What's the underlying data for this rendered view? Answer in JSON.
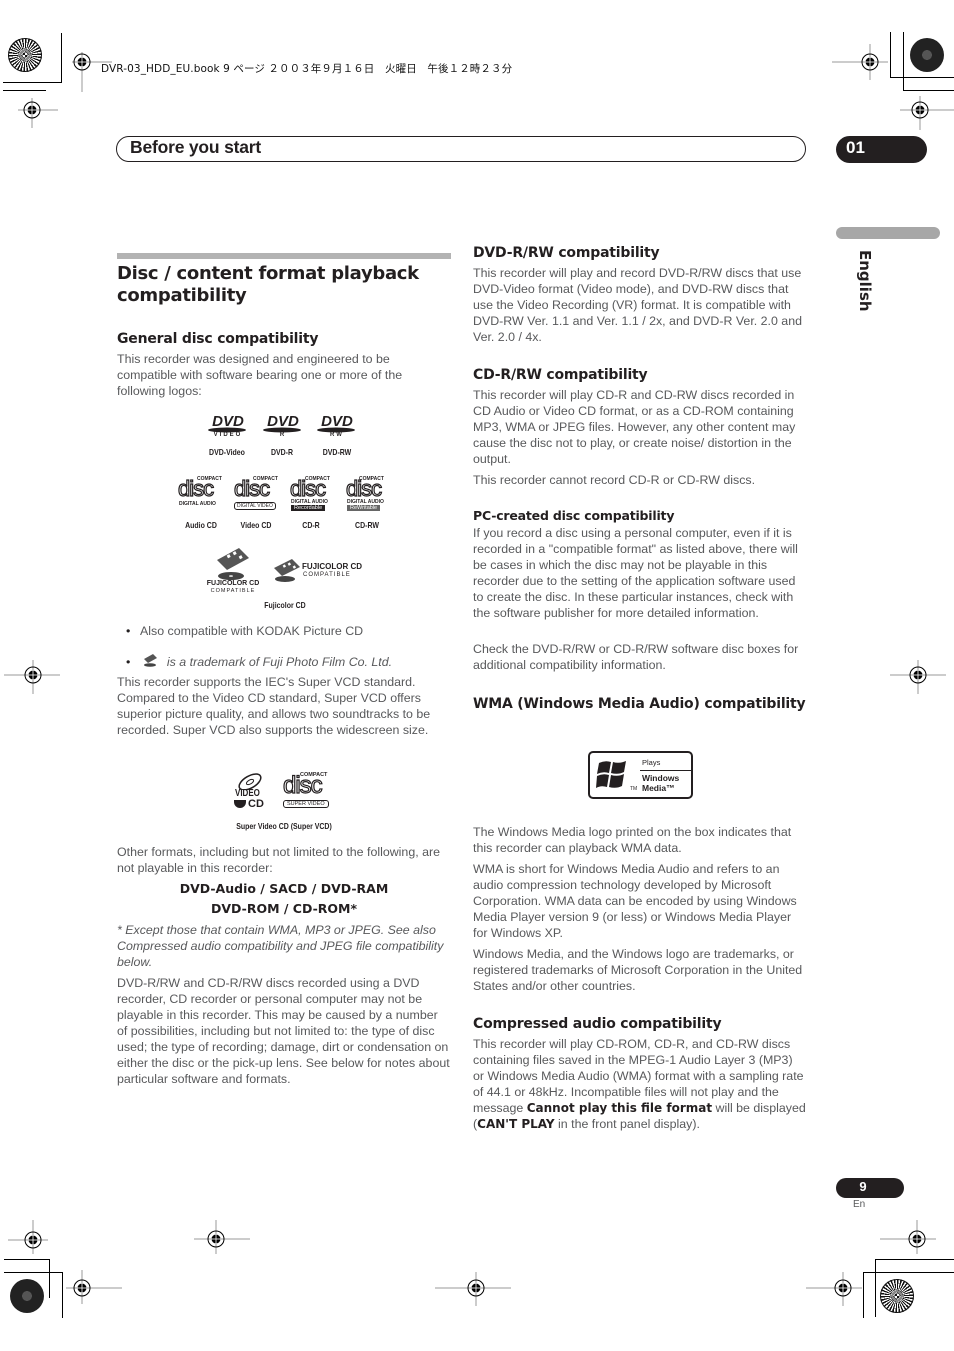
{
  "print_slug": "DVR-03_HDD_EU.book  9 ページ  ２００３年９月１６日　火曜日　午後１２時２３分",
  "header": {
    "title": "Before you start",
    "chapter": "01"
  },
  "side_tab": {
    "language": "English"
  },
  "left_column": {
    "section_title": "Disc / content format playback compatibility",
    "general": {
      "heading": "General disc compatibility",
      "intro": "This recorder was designed and engineered to be compatible with software bearing one or more of the following logos:",
      "dvd_logos": [
        {
          "sub": "VIDEO",
          "caption": "DVD-Video"
        },
        {
          "sub": "R",
          "caption": "DVD-R"
        },
        {
          "sub": "RW",
          "caption": "DVD-RW"
        }
      ],
      "cd_logos": [
        {
          "band": "DIGITAL AUDIO",
          "extra": "",
          "caption": "Audio CD"
        },
        {
          "band": "DIGITAL VIDEO",
          "extra": "",
          "caption": "Video CD"
        },
        {
          "band": "DIGITAL AUDIO",
          "extra": "Recordable",
          "caption": "CD-R"
        },
        {
          "band": "DIGITAL AUDIO",
          "extra": "ReWritable",
          "caption": "CD-RW"
        }
      ],
      "cd_logo_top": "COMPACT",
      "cd_logo_word": "disc",
      "fuji_logo_line1": "FUJICOLOR CD",
      "fuji_logo_line2": "COMPATIBLE",
      "fuji_caption": "Fujicolor CD",
      "bullets": [
        "Also compatible with KODAK Picture CD",
        "is a trademark of Fuji Photo Film Co. Ltd."
      ],
      "svcd_text": "This recorder supports the IEC's Super VCD standard. Compared to the Video CD standard, Super VCD offers superior picture quality, and allows two soundtracks to be recorded. Super VCD also supports the widescreen size.",
      "svcd_logo_video": "VIDEO",
      "svcd_logo_cd": "CD",
      "svcd_logo_band": "SUPER VIDEO",
      "svcd_caption": "Super Video CD (Super VCD)",
      "other_formats_text": "Other formats, including but not limited to the following, are not playable in this recorder:",
      "unplayable_line1": "DVD-Audio / SACD / DVD-RAM",
      "unplayable_line2": "DVD-ROM / CD-ROM*",
      "footnote": "* Except those that contain WMA, MP3 or JPEG. See also Compressed audio compatibility and JPEG file compatibility below.",
      "closing": "DVD-R/RW and CD-R/RW discs recorded using a DVD recorder, CD recorder or personal computer may not be playable in this recorder. This may be caused by a number of possibilities, including but not limited to: the type of disc used; the type of recording; damage, dirt or condensation on either the disc or the pick-up lens. See below for notes about particular software and formats."
    }
  },
  "right_column": {
    "dvd_rw": {
      "heading": "DVD-R/RW compatibility",
      "text": "This recorder will play and record DVD-R/RW discs that use DVD-Video format (Video mode), and DVD-RW discs that use the Video Recording (VR) format. It is compatible with DVD-RW Ver. 1.1 and Ver. 1.1 / 2x, and DVD-R Ver. 2.0 and Ver. 2.0 / 4x."
    },
    "cd_rw": {
      "heading": "CD-R/RW compatibility",
      "text": "This recorder will play CD-R and CD-RW discs recorded in CD Audio or Video CD format, or as a CD-ROM containing MP3, WMA or JPEG files. However, any other content may cause the disc not to play, or create noise/ distortion in the output.",
      "text2": "This recorder cannot record CD-R or CD-RW discs."
    },
    "pc_created": {
      "heading": "PC-created disc compatibility",
      "text": "If you record a disc using a personal computer, even if it is recorded in a \"compatible format\" as listed above, there will be cases in which the disc may not be playable in this recorder due to the setting of the application software used to create the disc. In these particular instances, check with the software publisher for more detailed information.",
      "text2": "Check the DVD-R/RW or CD-R/RW software disc boxes for additional compatibility information."
    },
    "wma": {
      "heading": "WMA (Windows Media Audio) compatibility",
      "logo_plays": "Plays",
      "logo_windows": "Windows",
      "logo_media": "Media™",
      "logo_tm": "TM",
      "text1": "The Windows Media logo printed on the box indicates that this recorder can playback WMA data.",
      "text2": "WMA is short for Windows Media Audio and refers to an audio compression technology developed by Microsoft Corporation. WMA data can be encoded by using Windows Media Player version 9 (or less) or Windows Media Player for Windows XP.",
      "text3": "Windows Media, and the Windows logo are trademarks, or registered trademarks of Microsoft Corporation in the United States and/or other countries."
    },
    "compressed": {
      "heading": "Compressed audio compatibility",
      "text_a": "This recorder will play CD-ROM, CD-R, and CD-RW discs containing files saved in the MPEG-1 Audio Layer 3 (MP3) or Windows Media Audio (WMA) format with a sampling rate of 44.1 or 48kHz. Incompatible files will not play and the message ",
      "bold_msg": "Cannot play this file format",
      "text_b": " will be displayed (",
      "bold_panel": "CAN'T PLAY",
      "text_c": " in the front panel display)."
    }
  },
  "footer": {
    "page_number": "9",
    "page_lang": "En"
  }
}
